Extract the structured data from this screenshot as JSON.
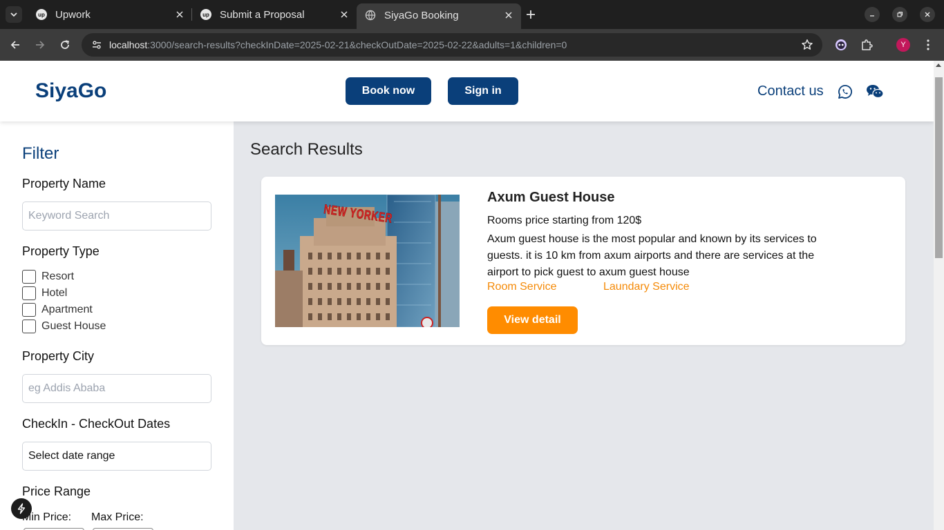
{
  "browser": {
    "tabs": [
      {
        "title": "Upwork",
        "favicon": "upwork-icon"
      },
      {
        "title": "Submit a Proposal",
        "favicon": "upwork-icon"
      },
      {
        "title": "SiyaGo Booking",
        "favicon": "globe-icon",
        "active": true
      }
    ],
    "favicon_text": "up",
    "url_host": "localhost",
    "url_rest": ":3000/search-results?checkInDate=2025-02-21&checkOutDate=2025-02-22&adults=1&children=0",
    "profile_initial": "Y"
  },
  "header": {
    "logo": "SiyaGo",
    "book_now": "Book now",
    "sign_in": "Sign in",
    "contact": "Contact us"
  },
  "filter": {
    "title": "Filter",
    "property_name_label": "Property Name",
    "property_name_placeholder": "Keyword Search",
    "property_type_label": "Property Type",
    "property_types": [
      "Resort",
      "Hotel",
      "Apartment",
      "Guest House"
    ],
    "property_city_label": "Property City",
    "property_city_placeholder": "eg Addis Ababa",
    "dates_label": "CheckIn - CheckOut Dates",
    "dates_value": "Select date range",
    "price_range_label": "Price Range",
    "min_price_label": "Min Price:",
    "max_price_label": "Max Price:"
  },
  "results": {
    "title": "Search Results",
    "items": [
      {
        "name": "Axum Guest House",
        "price": "Rooms price starting from 120$",
        "description": "Axum guest house is the most popular and known by its services to guests. it is 10 km from axum airports and there are services at the airport to pick guest to axum guest house",
        "services": [
          "Room Service",
          "Laundary Service"
        ],
        "cta": "View detail",
        "photo_sign": "NEW YORKER"
      }
    ]
  },
  "colors": {
    "brand": "#0a3f7a",
    "accent": "#ff8c00"
  }
}
